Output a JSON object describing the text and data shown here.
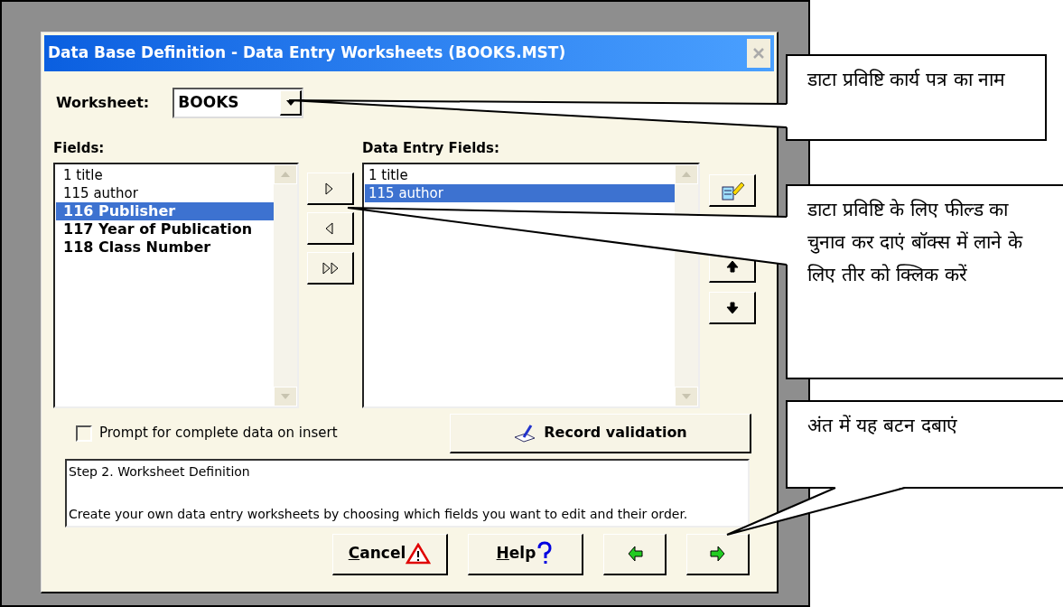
{
  "window": {
    "title": "Data Base Definition - Data Entry Worksheets (BOOKS.MST)"
  },
  "worksheet": {
    "label": "Worksheet:",
    "value": "BOOKS"
  },
  "fields": {
    "label": "Fields:",
    "items": [
      {
        "text": "1 title",
        "kind": "used",
        "selected": false
      },
      {
        "text": "115 author",
        "kind": "used",
        "selected": false
      },
      {
        "text": "116 Publisher",
        "kind": "unused",
        "selected": true
      },
      {
        "text": "117 Year of Publication",
        "kind": "unused",
        "selected": false
      },
      {
        "text": "118 Class Number",
        "kind": "unused",
        "selected": false
      }
    ]
  },
  "data_entry_fields": {
    "label": "Data Entry Fields:",
    "items": [
      {
        "text": "1 title",
        "selected": false
      },
      {
        "text": "115 author",
        "selected": true
      }
    ]
  },
  "prompt_checkbox": {
    "label": "Prompt for complete data on insert",
    "checked": false
  },
  "record_validation": {
    "label": "Record validation"
  },
  "description": [
    "Step 2. Worksheet Definition",
    "Create your own data entry worksheets by choosing which fields you want to edit and their order."
  ],
  "buttons": [
    {
      "label": "Cancel",
      "kind": "cancel"
    },
    {
      "label": "Help",
      "kind": "help"
    },
    {
      "kind": "back"
    },
    {
      "kind": "next"
    }
  ],
  "callouts": [
    {
      "text": "डाटा प्रविष्टि कार्य पत्र का नाम"
    },
    {
      "text": "डाटा प्रविष्टि के लिए फील्ड का चुनाव कर दाएं बॉक्स में लाने के लिए तीर को क्लिक करें"
    },
    {
      "text": "अंत में यह बटन दबाएं"
    }
  ]
}
